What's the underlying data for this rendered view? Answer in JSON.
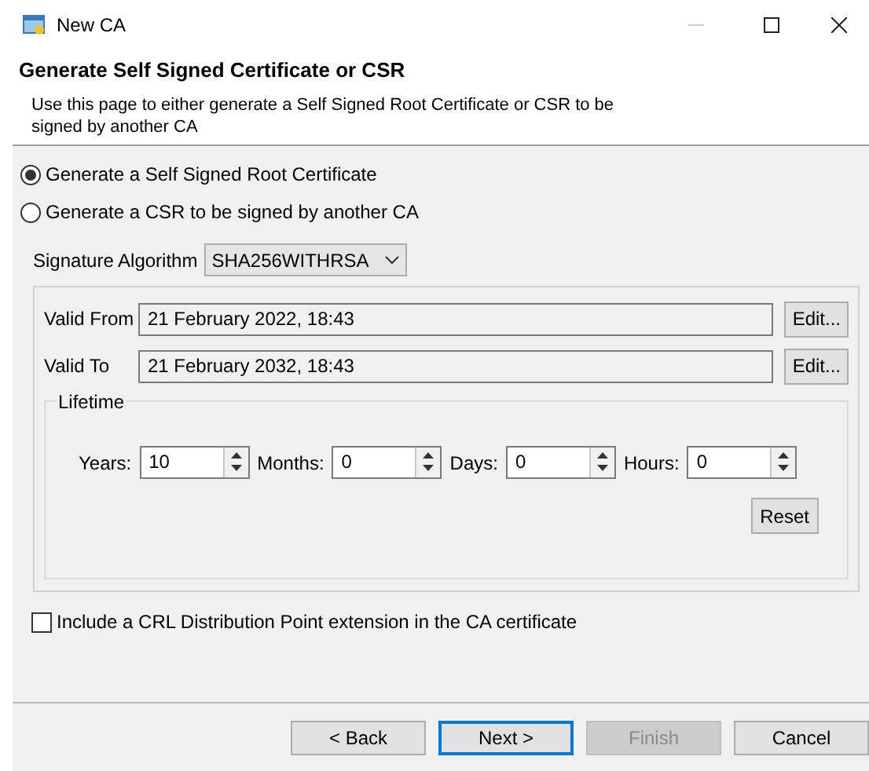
{
  "window": {
    "title": "New CA"
  },
  "header": {
    "title": "Generate Self Signed Certificate or CSR",
    "description": "Use this page to either generate a Self Signed Root Certificate or CSR to be signed by another CA"
  },
  "mode_options": [
    {
      "label": "Generate a Self Signed Root Certificate",
      "selected": true
    },
    {
      "label": "Generate a CSR to be signed by another CA",
      "selected": false
    }
  ],
  "signature_algorithm": {
    "label": "Signature Algorithm",
    "value": "SHA256WITHRSA"
  },
  "validity": [
    {
      "label": "Valid From",
      "value": "21 February 2022, 18:43",
      "button": "Edit..."
    },
    {
      "label": "Valid To",
      "value": "21 February 2032, 18:43",
      "button": "Edit..."
    }
  ],
  "lifetime": {
    "title": "Lifetime",
    "fields": [
      {
        "label": "Years:",
        "value": "10"
      },
      {
        "label": "Months:",
        "value": "0"
      },
      {
        "label": "Days:",
        "value": "0"
      },
      {
        "label": "Hours:",
        "value": "0"
      }
    ],
    "reset": "Reset"
  },
  "crl_option": {
    "label": "Include a CRL Distribution Point extension in the CA certificate",
    "checked": false
  },
  "buttons": [
    {
      "label": "< Back",
      "disabled": false,
      "default": false
    },
    {
      "label": "Next >",
      "disabled": false,
      "default": true
    },
    {
      "label": "Finish",
      "disabled": true,
      "default": false
    },
    {
      "label": "Cancel",
      "disabled": false,
      "default": false
    }
  ]
}
